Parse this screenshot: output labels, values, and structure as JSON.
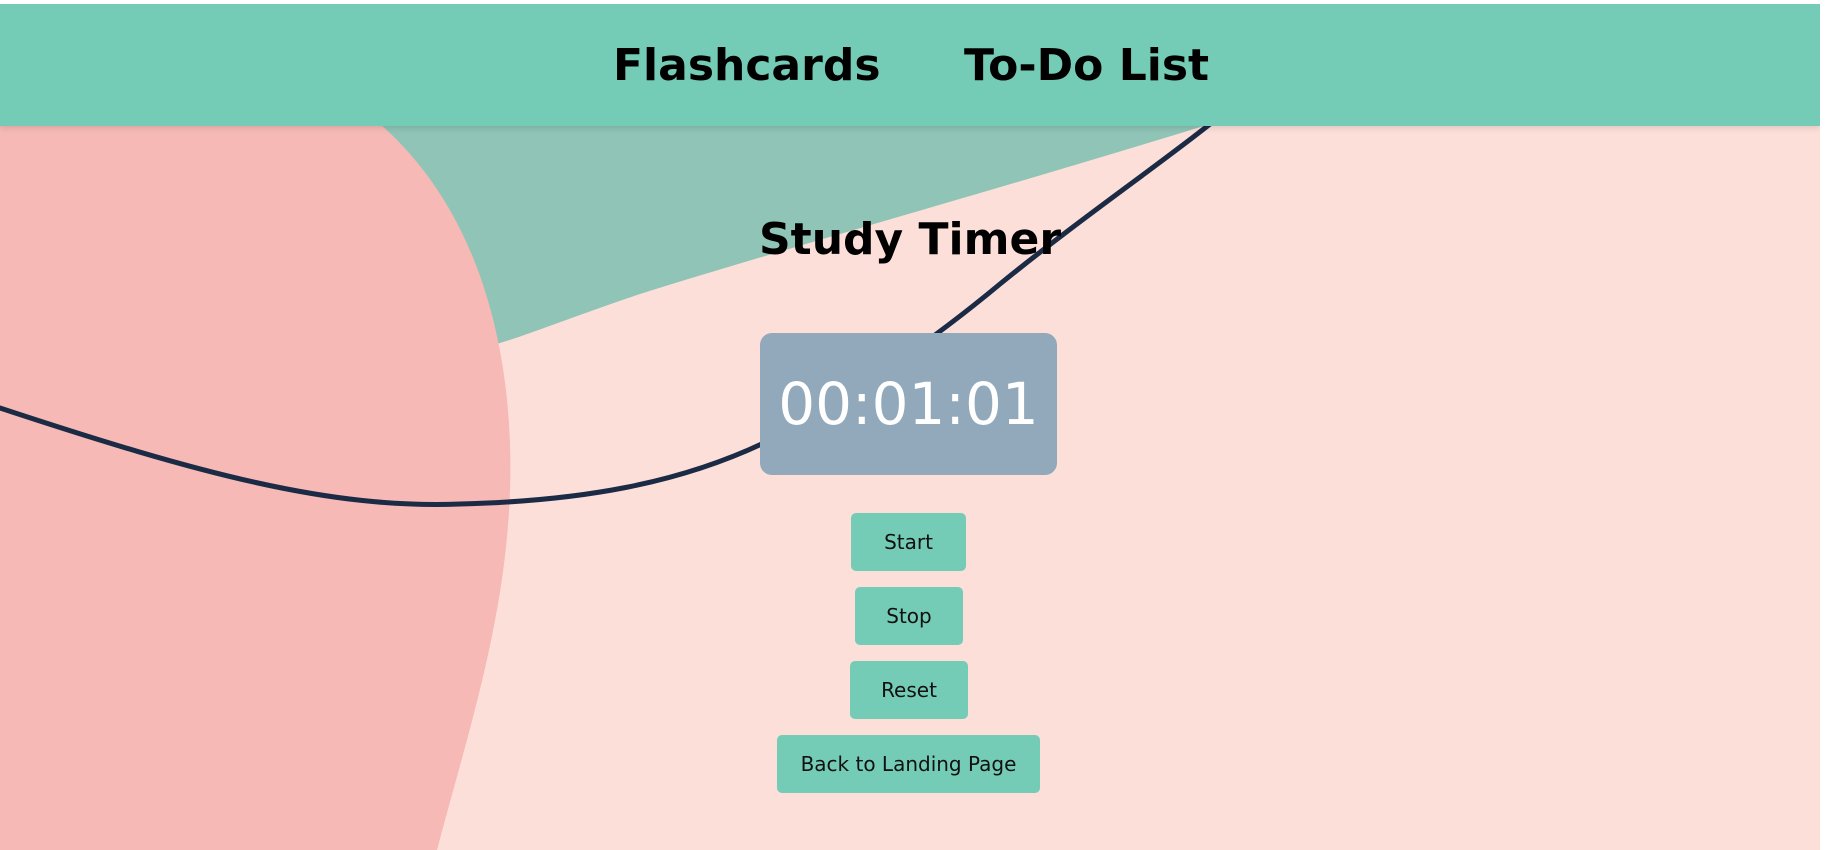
{
  "nav": {
    "flashcards_label": "Flashcards",
    "todo_label": "To-Do List"
  },
  "page": {
    "title": "Study Timer"
  },
  "timer": {
    "display": "00:01:01"
  },
  "buttons": {
    "start_label": "Start",
    "stop_label": "Stop",
    "reset_label": "Reset",
    "back_label": "Back to Landing Page"
  },
  "colors": {
    "navbar": "#74cbb6",
    "background": "#fcdfd9",
    "pink_blob": "#f6b9b5",
    "teal_shape": "#8fc4b6",
    "curve_line": "#1b2b45",
    "timer_box": "#92a9bc",
    "button": "#74cbb6"
  }
}
